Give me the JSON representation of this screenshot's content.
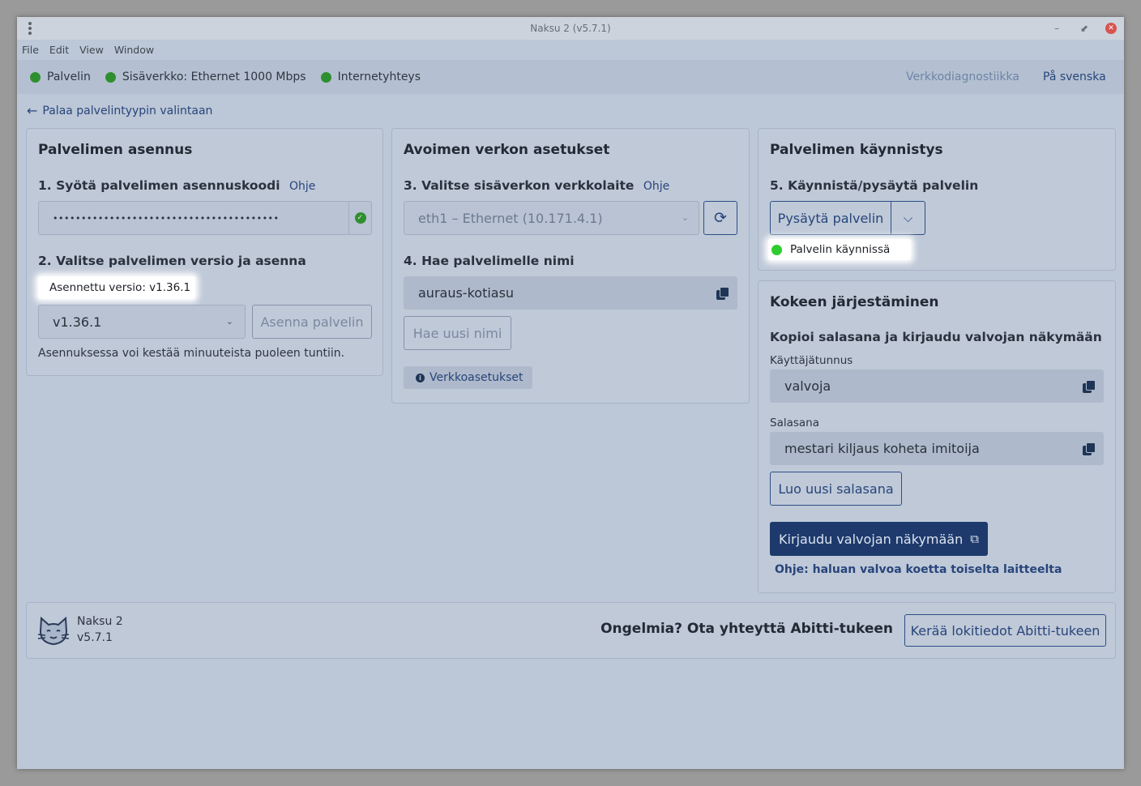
{
  "window": {
    "title": "Naksu 2 (v5.7.1)",
    "minimize": "–",
    "maximize": "⬋",
    "close": "✕"
  },
  "menu": {
    "items": [
      "File",
      "Edit",
      "View",
      "Window"
    ]
  },
  "status": {
    "items": [
      {
        "label": "Palvelin",
        "color": "#2f8f2f"
      },
      {
        "label": "Sisäverkko: Ethernet 1000 Mbps",
        "color": "#2f8f2f"
      },
      {
        "label": "Internetyhteys",
        "color": "#2f8f2f"
      }
    ],
    "diagnostics_link": "Verkkodiagnostiikka",
    "language_link": "På svenska"
  },
  "back_link": "Palaa palvelintyypin valintaan",
  "install": {
    "title": "Palvelimen asennus",
    "step1": "1. Syötä palvelimen asennuskoodi",
    "step1_help": "Ohje",
    "code_value": "••••••••••••••••••••••••••••••••••••••••",
    "step2": "2. Valitse palvelimen versio ja asenna",
    "installed_version": "Asennettu versio: v1.36.1",
    "version_selected": "v1.36.1",
    "install_button": "Asenna palvelin",
    "install_note": "Asennuksessa voi kestää minuuteista puoleen tuntiin."
  },
  "network": {
    "title": "Avoimen verkon asetukset",
    "step3": "3. Valitse sisäverkon verkkolaite",
    "step3_help": "Ohje",
    "device_selected": "eth1 – Ethernet (10.171.4.1)",
    "step4": "4. Hae palvelimelle nimi",
    "server_name": "auraus-kotiasu",
    "new_name_button": "Hae uusi nimi",
    "settings_button": "Verkkoasetukset"
  },
  "startup": {
    "title": "Palvelimen käynnistys",
    "step5": "5. Käynnistä/pysäytä palvelin",
    "stop_button": "Pysäytä palvelin",
    "running_status": "Palvelin käynnissä",
    "running_color": "#2ecc2e"
  },
  "exam": {
    "title": "Kokeen järjestäminen",
    "subtitle": "Kopioi salasana ja kirjaudu valvojan näkymään",
    "username_label": "Käyttäjätunnus",
    "username_value": "valvoja",
    "password_label": "Salasana",
    "password_value": "mestari kiljaus koheta imitoija",
    "new_password_button": "Luo uusi salasana",
    "login_button": "Kirjaudu valvojan näkymään",
    "help_link": "Ohje: haluan valvoa koetta toiselta laitteelta"
  },
  "footer": {
    "app_name": "Naksu 2",
    "app_version": "v5.7.1",
    "problem_text": "Ongelmia? Ota yhteyttä Abitti-tukeen",
    "collect_logs_button": "Kerää lokitiedot Abitti-tukeen"
  }
}
